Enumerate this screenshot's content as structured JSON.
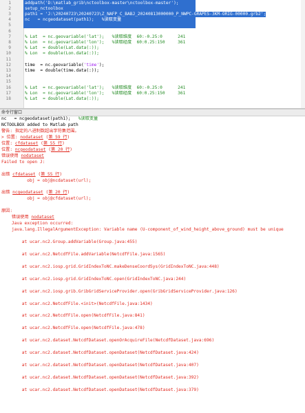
{
  "editor": {
    "lines": [
      {
        "n": "1",
        "fold": "",
        "selected": true,
        "segments": [
          {
            "t": "addpath(",
            "c": ""
          },
          {
            "t": "'D:\\matlab_grib\\nctoolbox-master\\nctoolbox-master'",
            "c": "str"
          },
          {
            "t": ");",
            "c": ""
          }
        ]
      },
      {
        "n": "2",
        "fold": "",
        "selected": true,
        "segments": [
          {
            "t": "setup_nctoolbox",
            "c": ""
          }
        ]
      },
      {
        "n": "3",
        "fold": "",
        "selected": true,
        "segments": [
          {
            "t": "path1 = ",
            "c": ""
          },
          {
            "t": "'J:\\20240723\\20240723\\Z_NAFP_C_BABJ_20240813000000_P_NWPC-GRAPES-3KM-ORIG-00000.grb2'",
            "c": "str"
          },
          {
            "t": ";",
            "c": ""
          }
        ]
      },
      {
        "n": "4",
        "fold": "",
        "selected": true,
        "segments": [
          {
            "t": "nc   = ncgeodataset(path1);   ",
            "c": ""
          },
          {
            "t": "%读取变量",
            "c": "cm"
          }
        ]
      },
      {
        "n": "5",
        "fold": "",
        "selected": false,
        "segments": []
      },
      {
        "n": "6",
        "fold": "",
        "selected": false,
        "segments": []
      },
      {
        "n": "7",
        "fold": "",
        "selected": false,
        "segments": [
          {
            "t": "% Lat  = nc.geovariable('lat');   %读取维度  60:-0.25:0      241",
            "c": "cm"
          }
        ]
      },
      {
        "n": "8",
        "fold": "",
        "selected": false,
        "segments": [
          {
            "t": "% Lon  = nc.geovariable('lon');   %读取经度  60:0.25:150     361",
            "c": "cm"
          }
        ]
      },
      {
        "n": "9",
        "fold": "",
        "selected": false,
        "segments": [
          {
            "t": "% Lat  = double(Lat.data(:));",
            "c": "cm"
          }
        ]
      },
      {
        "n": "10",
        "fold": "",
        "selected": false,
        "segments": [
          {
            "t": "% Lon  = double(Lon.data(:));",
            "c": "cm"
          }
        ]
      },
      {
        "n": "11",
        "fold": "",
        "selected": false,
        "segments": []
      },
      {
        "n": "12",
        "fold": "",
        "selected": false,
        "segments": [
          {
            "t": "time  = nc.geovariable(",
            "c": ""
          },
          {
            "t": "'time'",
            "c": "str"
          },
          {
            "t": ");",
            "c": ""
          }
        ]
      },
      {
        "n": "13",
        "fold": "",
        "selected": false,
        "segments": [
          {
            "t": "time  = double(time.data(:));",
            "c": ""
          }
        ]
      },
      {
        "n": "14",
        "fold": "",
        "selected": false,
        "segments": []
      },
      {
        "n": "15",
        "fold": "",
        "selected": false,
        "segments": []
      },
      {
        "n": "16",
        "fold": "",
        "selected": false,
        "segments": [
          {
            "t": "% Lat  = nc.geovariable('lat');   %读取维度  60:-0.25:0      241",
            "c": "cm"
          }
        ]
      },
      {
        "n": "17",
        "fold": "",
        "selected": false,
        "segments": [
          {
            "t": "% Lon  = nc.geovariable('lon');   %读取经度  60:0.25:150     361",
            "c": "cm"
          }
        ]
      },
      {
        "n": "18",
        "fold": "",
        "selected": false,
        "segments": [
          {
            "t": "% Lat  = double(Lat.data(:));",
            "c": "cm"
          }
        ]
      }
    ]
  },
  "command_window": {
    "title": "命令行窗口",
    "lines": [
      {
        "segments": [
          {
            "t": "nc   = ncgeodataset(path1);   ",
            "c": "blk"
          },
          {
            "t": "%读取变量",
            "c": "cm"
          }
        ]
      },
      {
        "segments": [
          {
            "t": "NCTOOLBOX added to Matlab path",
            "c": "blk"
          }
        ]
      },
      {
        "segments": [
          {
            "t": "警告: 指定的八进制数超出字符集范围。",
            "c": "red"
          }
        ]
      },
      {
        "segments": [
          {
            "t": "> 位置: ",
            "c": "red"
          },
          {
            "t": "nodataset",
            "c": "link"
          },
          {
            "t": " (",
            "c": "red"
          },
          {
            "t": "第 59 行",
            "c": "link"
          },
          {
            "t": ")",
            "c": "red"
          }
        ]
      },
      {
        "segments": [
          {
            "t": "位置: ",
            "c": "red"
          },
          {
            "t": "cfdataset",
            "c": "link"
          },
          {
            "t": " (",
            "c": "red"
          },
          {
            "t": "第 55 行",
            "c": "link"
          },
          {
            "t": ")",
            "c": "red"
          }
        ]
      },
      {
        "segments": [
          {
            "t": "位置: ",
            "c": "red"
          },
          {
            "t": "ncgeodataset",
            "c": "link"
          },
          {
            "t": " (",
            "c": "red"
          },
          {
            "t": "第 20 行",
            "c": "link"
          },
          {
            "t": ")",
            "c": "red"
          }
        ]
      },
      {
        "segments": [
          {
            "t": "错误使用 ",
            "c": "red"
          },
          {
            "t": "nodataset",
            "c": "link"
          }
        ]
      },
      {
        "segments": [
          {
            "t": "Failed to open J:",
            "c": "red"
          }
        ]
      },
      {
        "segments": []
      },
      {
        "segments": [
          {
            "t": "出错 ",
            "c": "red"
          },
          {
            "t": "cfdataset",
            "c": "link"
          },
          {
            "t": " (",
            "c": "red"
          },
          {
            "t": "第 55 行",
            "c": "link"
          },
          {
            "t": ")",
            "c": "red"
          }
        ]
      },
      {
        "segments": [
          {
            "t": "          obj = obj@ncdataset(url);",
            "c": "red"
          }
        ]
      },
      {
        "segments": []
      },
      {
        "segments": [
          {
            "t": "出错 ",
            "c": "red"
          },
          {
            "t": "ncgeodataset",
            "c": "link"
          },
          {
            "t": " (",
            "c": "red"
          },
          {
            "t": "第 20 行",
            "c": "link"
          },
          {
            "t": ")",
            "c": "red"
          }
        ]
      },
      {
        "segments": [
          {
            "t": "          obj = obj@cfdataset(url);",
            "c": "red"
          }
        ]
      },
      {
        "segments": []
      },
      {
        "segments": [
          {
            "t": "原因:",
            "c": "red"
          }
        ]
      },
      {
        "segments": [
          {
            "t": "    错误使用 ",
            "c": "red"
          },
          {
            "t": "nodataset",
            "c": "link"
          }
        ]
      },
      {
        "segments": [
          {
            "t": "    Java exception occurred:",
            "c": "red"
          }
        ]
      },
      {
        "segments": [
          {
            "t": "    java.lang.IllegalArgumentException: Variable name (U-component_of_wind_height_above_ground) must be unique",
            "c": "red"
          }
        ]
      },
      {
        "segments": []
      },
      {
        "segments": [
          {
            "t": "        at ucar.nc2.Group.addVariable(Group.java:455)",
            "c": "red"
          }
        ]
      },
      {
        "segments": []
      },
      {
        "segments": [
          {
            "t": "        at ucar.nc2.NetcdfFile.addVariable(NetcdfFile.java:1565)",
            "c": "red"
          }
        ]
      },
      {
        "segments": []
      },
      {
        "segments": [
          {
            "t": "        at ucar.nc2.iosp.grid.GridIndexToNC.makeDenseCoordSys(GridIndexToNC.java:448)",
            "c": "red"
          }
        ]
      },
      {
        "segments": []
      },
      {
        "segments": [
          {
            "t": "        at ucar.nc2.iosp.grid.GridIndexToNC.open(GridIndexToNC.java:244)",
            "c": "red"
          }
        ]
      },
      {
        "segments": []
      },
      {
        "segments": [
          {
            "t": "        at ucar.nc2.iosp.grib.GribGridServiceProvider.open(GribGridServiceProvider.java:126)",
            "c": "red"
          }
        ]
      },
      {
        "segments": []
      },
      {
        "segments": [
          {
            "t": "        at ucar.nc2.NetcdfFile.<init>(NetcdfFile.java:1434)",
            "c": "red"
          }
        ]
      },
      {
        "segments": []
      },
      {
        "segments": [
          {
            "t": "        at ucar.nc2.NetcdfFile.open(NetcdfFile.java:841)",
            "c": "red"
          }
        ]
      },
      {
        "segments": []
      },
      {
        "segments": [
          {
            "t": "        at ucar.nc2.NetcdfFile.open(NetcdfFile.java:478)",
            "c": "red"
          }
        ]
      },
      {
        "segments": []
      },
      {
        "segments": [
          {
            "t": "        at ucar.nc2.dataset.NetcdfDataset.openOrAcquireFile(NetcdfDataset.java:696)",
            "c": "red"
          }
        ]
      },
      {
        "segments": []
      },
      {
        "segments": [
          {
            "t": "        at ucar.nc2.dataset.NetcdfDataset.openDataset(NetcdfDataset.java:424)",
            "c": "red"
          }
        ]
      },
      {
        "segments": []
      },
      {
        "segments": [
          {
            "t": "        at ucar.nc2.dataset.NetcdfDataset.openDataset(NetcdfDataset.java:407)",
            "c": "red"
          }
        ]
      },
      {
        "segments": []
      },
      {
        "segments": [
          {
            "t": "        at ucar.nc2.dataset.NetcdfDataset.openDataset(NetcdfDataset.java:392)",
            "c": "red"
          }
        ]
      },
      {
        "segments": []
      },
      {
        "segments": [
          {
            "t": "        at ucar.nc2.dataset.NetcdfDataset.openDataset(NetcdfDataset.java:379)",
            "c": "red"
          }
        ]
      }
    ]
  }
}
